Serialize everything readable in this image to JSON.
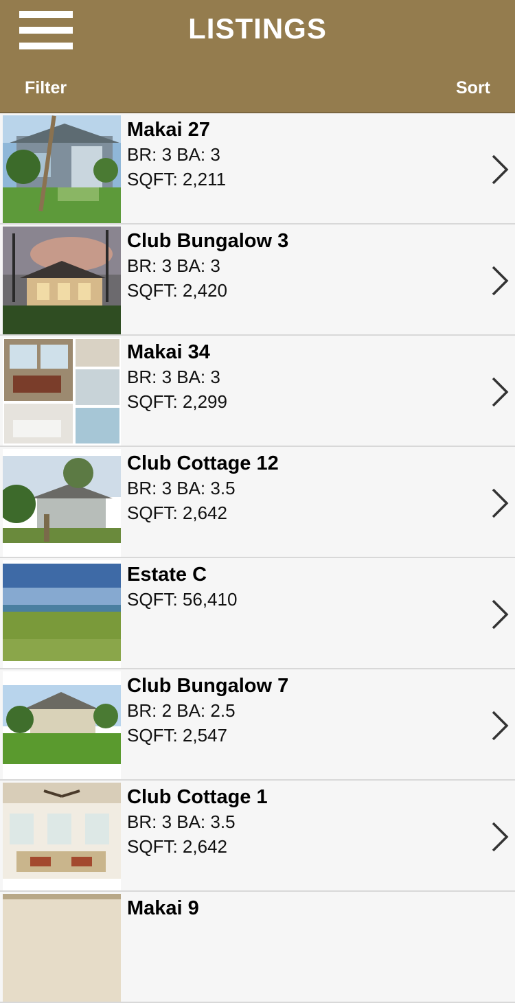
{
  "header": {
    "title": "LISTINGS",
    "filter_label": "Filter",
    "sort_label": "Sort",
    "menu_icon": "hamburger-menu-icon",
    "bg_color": "#947c4e"
  },
  "listings": [
    {
      "name": "Makai 27",
      "line1": "BR: 3 BA: 3",
      "line2": "SQFT: 2,211"
    },
    {
      "name": "Club Bungalow 3",
      "line1": "BR: 3 BA: 3",
      "line2": "SQFT: 2,420"
    },
    {
      "name": "Makai 34",
      "line1": "BR: 3 BA: 3",
      "line2": "SQFT: 2,299"
    },
    {
      "name": "Club Cottage 12",
      "line1": "BR: 3 BA: 3.5",
      "line2": "SQFT: 2,642"
    },
    {
      "name": "Estate C",
      "line1": "SQFT: 56,410",
      "line2": ""
    },
    {
      "name": "Club Bungalow 7",
      "line1": "BR: 2 BA: 2.5",
      "line2": "SQFT: 2,547"
    },
    {
      "name": "Club Cottage 1",
      "line1": "BR: 3 BA: 3.5",
      "line2": "SQFT: 2,642"
    },
    {
      "name": "Makai 9",
      "line1": "",
      "line2": ""
    }
  ],
  "row_icon": "chevron-right-icon"
}
